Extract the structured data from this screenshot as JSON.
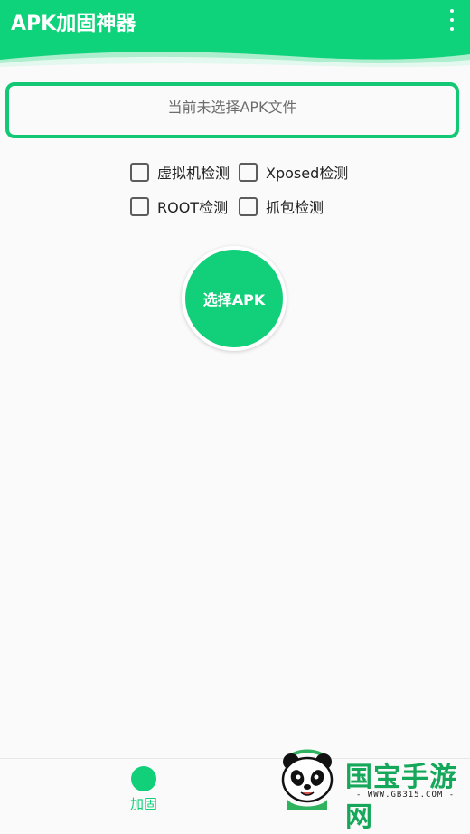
{
  "app": {
    "title": "APK加固神器",
    "menu_icon": "more-vert-icon"
  },
  "file_status": "当前未选择APK文件",
  "options": [
    {
      "label": "虚拟机检测",
      "checked": false
    },
    {
      "label": "Xposed检测",
      "checked": false
    },
    {
      "label": "ROOT检测",
      "checked": false
    },
    {
      "label": "抓包检测",
      "checked": false
    }
  ],
  "select_button_label": "选择APK",
  "bottom_nav": {
    "items": [
      {
        "label": "加固",
        "active": true
      }
    ]
  },
  "watermark": {
    "brand": "国宝手游网",
    "url": "- WWW.GB315.COM -"
  },
  "colors": {
    "accent": "#12cf7a",
    "border": "#13c874",
    "text_muted": "#6d6d6d"
  }
}
